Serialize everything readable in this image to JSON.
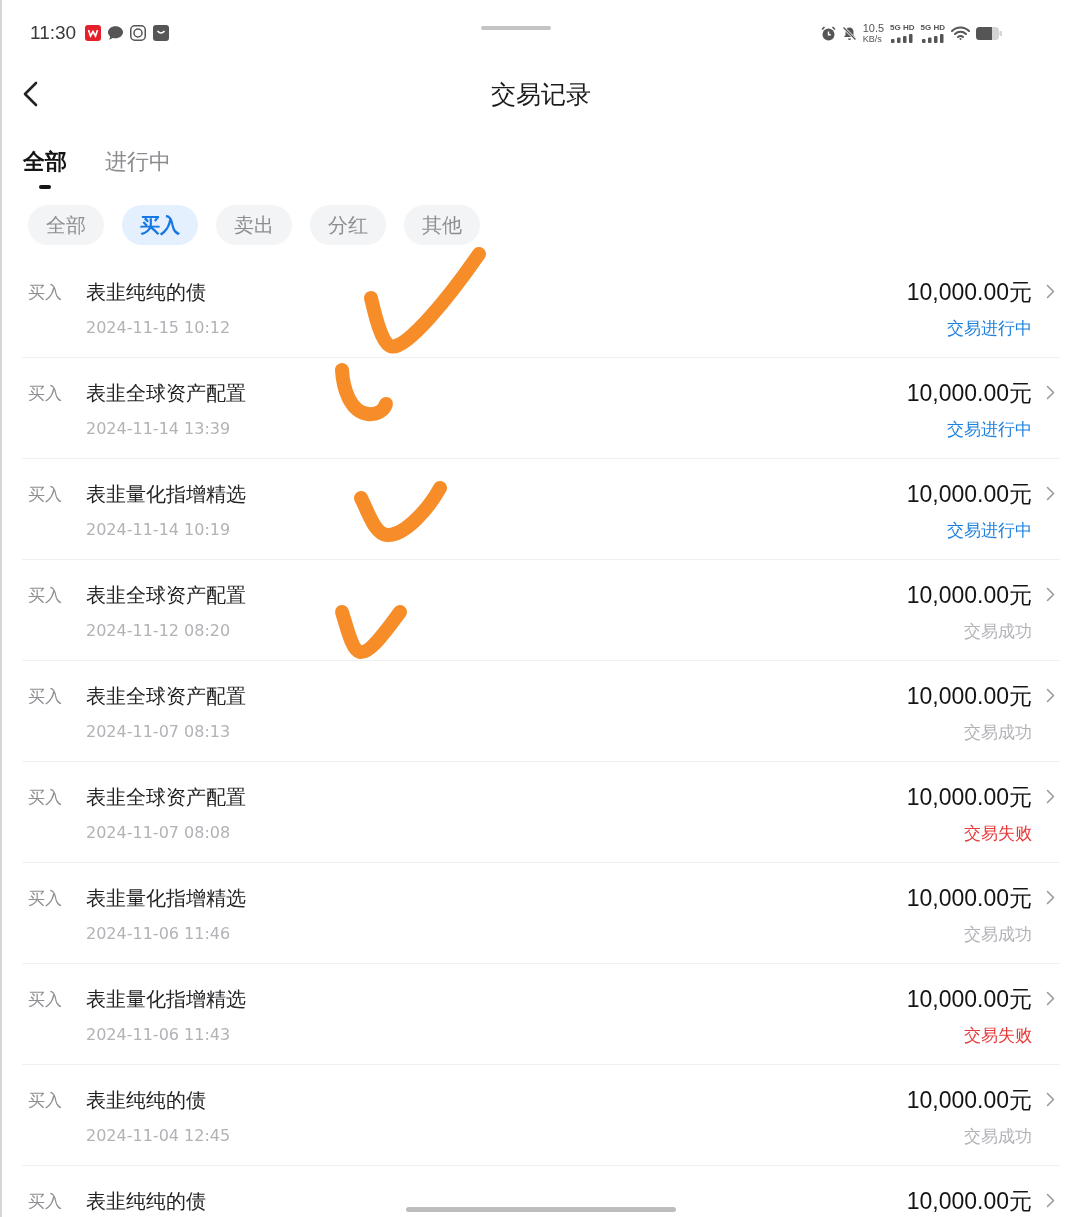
{
  "status_bar": {
    "time": "11:30",
    "network_speed": {
      "value": "10.5",
      "unit": "KB/s"
    },
    "signals": [
      {
        "label": "5G HD"
      },
      {
        "label": "5G HD"
      }
    ]
  },
  "header": {
    "title": "交易记录"
  },
  "tabs": [
    {
      "label": "全部",
      "selected": true
    },
    {
      "label": "进行中",
      "selected": false
    }
  ],
  "filters": [
    {
      "label": "全部",
      "selected": false
    },
    {
      "label": "买入",
      "selected": true
    },
    {
      "label": "卖出",
      "selected": false
    },
    {
      "label": "分红",
      "selected": false
    },
    {
      "label": "其他",
      "selected": false
    }
  ],
  "transactions": [
    {
      "type": "买入",
      "name": "表韭纯纯的债",
      "date": "2024-11-15 10:12",
      "amount": "10,000.00元",
      "status": "交易进行中",
      "color": "#1e80de",
      "hand_mark": true
    },
    {
      "type": "买入",
      "name": "表韭全球资产配置",
      "date": "2024-11-14 13:39",
      "amount": "10,000.00元",
      "status": "交易进行中",
      "color": "#1e80de",
      "hand_mark": true
    },
    {
      "type": "买入",
      "name": "表韭量化指增精选",
      "date": "2024-11-14 10:19",
      "amount": "10,000.00元",
      "status": "交易进行中",
      "color": "#1e80de",
      "hand_mark": true
    },
    {
      "type": "买入",
      "name": "表韭全球资产配置",
      "date": "2024-11-12 08:20",
      "amount": "10,000.00元",
      "status": "交易成功",
      "color": "#b2b2b8",
      "hand_mark": true
    },
    {
      "type": "买入",
      "name": "表韭全球资产配置",
      "date": "2024-11-07 08:13",
      "amount": "10,000.00元",
      "status": "交易成功",
      "color": "#b2b2b8",
      "hand_mark": false
    },
    {
      "type": "买入",
      "name": "表韭全球资产配置",
      "date": "2024-11-07 08:08",
      "amount": "10,000.00元",
      "status": "交易失败",
      "color": "#e63a3a",
      "hand_mark": false
    },
    {
      "type": "买入",
      "name": "表韭量化指增精选",
      "date": "2024-11-06 11:46",
      "amount": "10,000.00元",
      "status": "交易成功",
      "color": "#b2b2b8",
      "hand_mark": false
    },
    {
      "type": "买入",
      "name": "表韭量化指增精选",
      "date": "2024-11-06 11:43",
      "amount": "10,000.00元",
      "status": "交易失败",
      "color": "#e63a3a",
      "hand_mark": false
    },
    {
      "type": "买入",
      "name": "表韭纯纯的债",
      "date": "2024-11-04 12:45",
      "amount": "10,000.00元",
      "status": "交易成功",
      "color": "#b2b2b8",
      "hand_mark": false
    },
    {
      "type": "买入",
      "name": "表韭纯纯的债",
      "amount": "10,000.00元",
      "hand_mark": false
    }
  ]
}
